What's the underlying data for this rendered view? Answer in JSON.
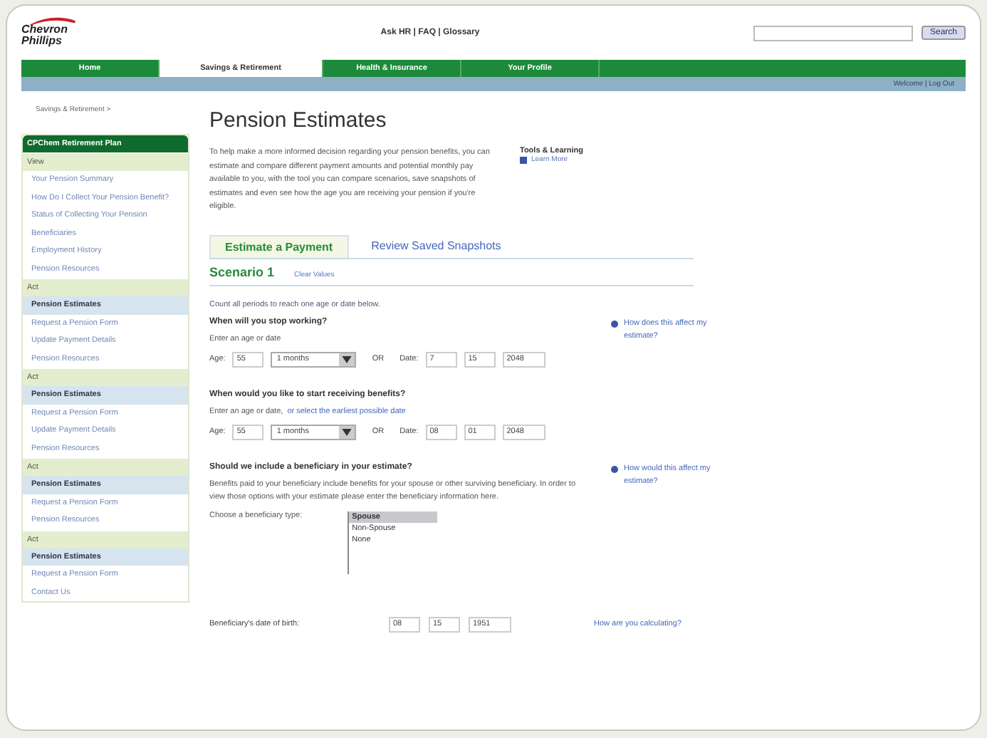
{
  "header": {
    "logo": "Chevron Phillips",
    "utility_links": "Ask HR | FAQ | Glossary",
    "search": {
      "button": "Search"
    }
  },
  "nav": [
    {
      "label": "Home",
      "selected": false
    },
    {
      "label": "Savings & Retirement",
      "selected": true
    },
    {
      "label": "Health & Insurance",
      "selected": false
    },
    {
      "label": "Your Profile",
      "selected": false
    }
  ],
  "subbar": "Welcome | Log Out",
  "breadcrumb": "Savings & Retirement >",
  "sidebar": {
    "title": "CPChem Retirement Plan",
    "sections": [
      {
        "heading": "View",
        "items": [
          {
            "label": "Your Pension Summary",
            "selected": false
          },
          {
            "label": "How Do I Collect Your Pension Benefit?",
            "selected": false
          },
          {
            "label": "Status of Collecting Your Pension",
            "selected": false
          },
          {
            "label": "Beneficiaries",
            "selected": false
          },
          {
            "label": "Employment History",
            "selected": false
          },
          {
            "label": "Pension Resources",
            "selected": false
          }
        ]
      },
      {
        "heading": "Act",
        "items": [
          {
            "label": "Pension Estimates",
            "selected": true
          },
          {
            "label": "Request a Pension Form",
            "selected": false
          },
          {
            "label": "Update Payment Details",
            "selected": false
          },
          {
            "label": "Pension Resources",
            "selected": false
          }
        ]
      },
      {
        "heading": "Act",
        "items": [
          {
            "label": "Pension Estimates",
            "selected": true
          },
          {
            "label": "Request a Pension Form",
            "selected": false
          },
          {
            "label": "Update Payment Details",
            "selected": false
          },
          {
            "label": "Pension Resources",
            "selected": false
          }
        ]
      },
      {
        "heading": "Act",
        "items": [
          {
            "label": "Pension Estimates",
            "selected": true
          },
          {
            "label": "Request a Pension Form",
            "selected": false
          },
          {
            "label": "Pension Resources",
            "selected": false
          }
        ]
      },
      {
        "heading": "Act",
        "items": [
          {
            "label": "Pension Estimates",
            "selected": true
          },
          {
            "label": "Request a Pension Form",
            "selected": false
          },
          {
            "label": "Contact Us",
            "selected": false
          }
        ]
      }
    ]
  },
  "main": {
    "title": "Pension Estimates",
    "intro": "To help make a more informed decision regarding your pension benefits, you can estimate and compare different payment amounts and potential monthly pay available to you, with the tool you can compare scenarios, save snapshots of estimates and even see how the age you are receiving your pension if you're eligible.",
    "tools": {
      "heading": "Tools & Learning",
      "link": "Learn More"
    },
    "tabs": [
      {
        "label": "Estimate a Payment",
        "selected": true
      },
      {
        "label": "Review Saved Snapshots",
        "selected": false
      }
    ],
    "scenario": {
      "title": "Scenario 1",
      "clear": "Clear Values"
    },
    "note": "Count all periods to reach one age or date below.",
    "questions": [
      {
        "question": "When will you stop working?",
        "hint": "Enter an age or date",
        "age_label": "Age:",
        "age": "55",
        "months": "1 months",
        "or": "OR",
        "date_label": "Date:",
        "date": [
          "7",
          "15",
          "2048"
        ],
        "help": "How does this affect my estimate?"
      },
      {
        "question": "When would you like to start receiving benefits?",
        "hint": "Enter an age or date,",
        "hint_link": "or select the earliest possible date",
        "age_label": "Age:",
        "age": "55",
        "months": "1 months",
        "or": "OR",
        "date_label": "Date:",
        "date": [
          "08",
          "01",
          "2048"
        ]
      }
    ],
    "beneficiary": {
      "question": "Should we include a beneficiary in your estimate?",
      "text": "Benefits paid to your beneficiary include benefits for your spouse or other surviving beneficiary. In order to view those options with your estimate please enter the beneficiary information here.",
      "help": "How would this affect my estimate?",
      "choose_label": "Choose a beneficiary type:",
      "options": [
        {
          "label": "Spouse",
          "selected": true
        },
        {
          "label": "Non-Spouse",
          "selected": false
        },
        {
          "label": "None",
          "selected": false
        }
      ]
    },
    "birth": {
      "label": "Beneficiary's date of birth:",
      "fields": [
        "08",
        "15",
        "1951"
      ],
      "link": "How are you calculating?"
    }
  }
}
